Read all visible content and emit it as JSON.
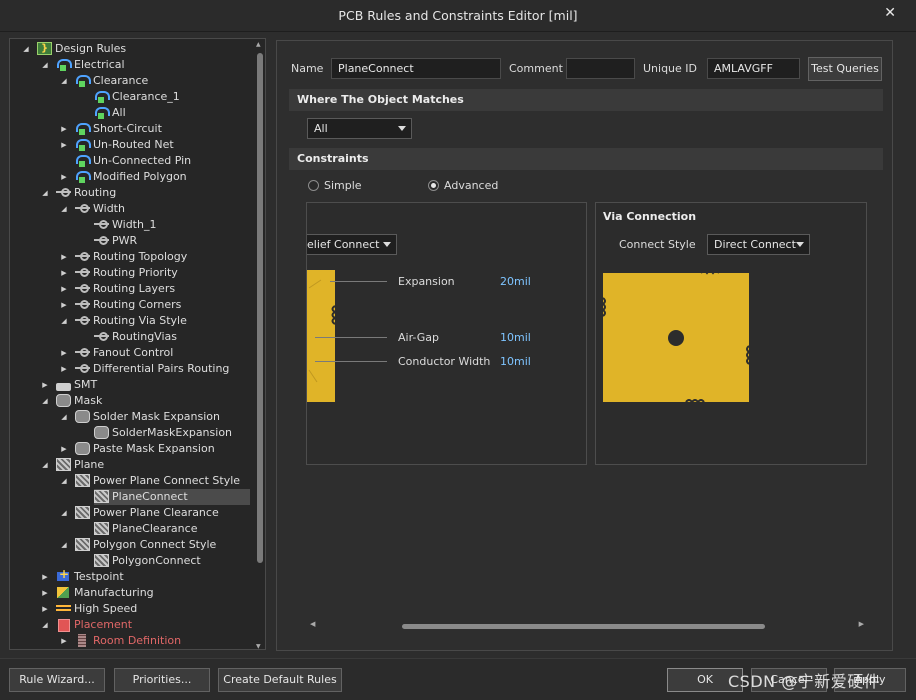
{
  "window": {
    "title": "PCB Rules and Constraints Editor [mil]"
  },
  "tree": {
    "items": [
      {
        "label": "Design Rules",
        "icon": "design-rules-icon",
        "depth": 0,
        "arrow": "down"
      },
      {
        "label": "Electrical",
        "icon": "electrical-icon",
        "depth": 1,
        "arrow": "down"
      },
      {
        "label": "Clearance",
        "icon": "electrical-icon",
        "depth": 2,
        "arrow": "down"
      },
      {
        "label": "Clearance_1",
        "icon": "electrical-icon",
        "depth": 3,
        "arrow": ""
      },
      {
        "label": "All",
        "icon": "electrical-icon",
        "depth": 3,
        "arrow": ""
      },
      {
        "label": "Short-Circuit",
        "icon": "electrical-icon",
        "depth": 2,
        "arrow": "right"
      },
      {
        "label": "Un-Routed Net",
        "icon": "electrical-icon",
        "depth": 2,
        "arrow": "right"
      },
      {
        "label": "Un-Connected Pin",
        "icon": "electrical-icon",
        "depth": 2,
        "arrow": ""
      },
      {
        "label": "Modified Polygon",
        "icon": "electrical-icon",
        "depth": 2,
        "arrow": "right"
      },
      {
        "label": "Routing",
        "icon": "routing-icon",
        "depth": 1,
        "arrow": "down"
      },
      {
        "label": "Width",
        "icon": "routing-icon",
        "depth": 2,
        "arrow": "down"
      },
      {
        "label": "Width_1",
        "icon": "routing-icon",
        "depth": 3,
        "arrow": ""
      },
      {
        "label": "PWR",
        "icon": "routing-icon",
        "depth": 3,
        "arrow": ""
      },
      {
        "label": "Routing Topology",
        "icon": "routing-icon",
        "depth": 2,
        "arrow": "right"
      },
      {
        "label": "Routing Priority",
        "icon": "routing-icon",
        "depth": 2,
        "arrow": "right"
      },
      {
        "label": "Routing Layers",
        "icon": "routing-icon",
        "depth": 2,
        "arrow": "right"
      },
      {
        "label": "Routing Corners",
        "icon": "routing-icon",
        "depth": 2,
        "arrow": "right"
      },
      {
        "label": "Routing Via Style",
        "icon": "routing-icon",
        "depth": 2,
        "arrow": "down"
      },
      {
        "label": "RoutingVias",
        "icon": "routing-icon",
        "depth": 3,
        "arrow": ""
      },
      {
        "label": "Fanout Control",
        "icon": "routing-icon",
        "depth": 2,
        "arrow": "right"
      },
      {
        "label": "Differential Pairs Routing",
        "icon": "routing-icon",
        "depth": 2,
        "arrow": "right"
      },
      {
        "label": "SMT",
        "icon": "smt-icon",
        "depth": 1,
        "arrow": "right"
      },
      {
        "label": "Mask",
        "icon": "mask-icon",
        "depth": 1,
        "arrow": "down"
      },
      {
        "label": "Solder Mask Expansion",
        "icon": "mask-icon",
        "depth": 2,
        "arrow": "down"
      },
      {
        "label": "SolderMaskExpansion",
        "icon": "mask-icon",
        "depth": 3,
        "arrow": ""
      },
      {
        "label": "Paste Mask Expansion",
        "icon": "mask-icon",
        "depth": 2,
        "arrow": "right"
      },
      {
        "label": "Plane",
        "icon": "plane-icon",
        "depth": 1,
        "arrow": "down"
      },
      {
        "label": "Power Plane Connect Style",
        "icon": "plane-icon",
        "depth": 2,
        "arrow": "down"
      },
      {
        "label": "PlaneConnect",
        "icon": "plane-icon",
        "depth": 3,
        "arrow": "",
        "selected": true
      },
      {
        "label": "Power Plane Clearance",
        "icon": "plane-icon",
        "depth": 2,
        "arrow": "down"
      },
      {
        "label": "PlaneClearance",
        "icon": "plane-icon",
        "depth": 3,
        "arrow": ""
      },
      {
        "label": "Polygon Connect Style",
        "icon": "plane-icon",
        "depth": 2,
        "arrow": "down"
      },
      {
        "label": "PolygonConnect",
        "icon": "plane-icon",
        "depth": 3,
        "arrow": ""
      },
      {
        "label": "Testpoint",
        "icon": "testpoint-icon",
        "depth": 1,
        "arrow": "right"
      },
      {
        "label": "Manufacturing",
        "icon": "manufacturing-icon",
        "depth": 1,
        "arrow": "right"
      },
      {
        "label": "High Speed",
        "icon": "high-speed-icon",
        "depth": 1,
        "arrow": "right"
      },
      {
        "label": "Placement",
        "icon": "placement-icon",
        "depth": 1,
        "arrow": "down",
        "red": true
      },
      {
        "label": "Room Definition",
        "icon": "room-definition-icon",
        "depth": 2,
        "arrow": "right",
        "red": true
      }
    ]
  },
  "rule": {
    "name_label": "Name",
    "name_value": "PlaneConnect",
    "comment_label": "Comment",
    "comment_value": "",
    "uid_label": "Unique ID",
    "uid_value": "AMLAVGFF",
    "test_queries": "Test Queries"
  },
  "where": {
    "header": "Where The Object Matches",
    "selected": "All"
  },
  "constraints": {
    "header": "Constraints",
    "simple_label": "Simple",
    "advanced_label": "Advanced",
    "mode": "Advanced",
    "left_dropdown": "elief Connect",
    "expansion_label": "Expansion",
    "expansion_value": "20mil",
    "airgap_label": "Air-Gap",
    "airgap_value": "10mil",
    "conductor_label": "Conductor Width",
    "conductor_value": "10mil",
    "via_header": "Via Connection",
    "connect_style_label": "Connect Style",
    "connect_style_value": "Direct Connect"
  },
  "buttons": {
    "rule_wizard": "Rule Wizard...",
    "priorities": "Priorities...",
    "create_default": "Create Default Rules",
    "ok": "OK",
    "cancel": "Cancel",
    "apply": "Apply"
  },
  "watermark": "CSDN @宁新爱硬件",
  "colors": {
    "copper": "#e0b428",
    "accent_value": "#7ec4ff",
    "warning_text": "#e06767"
  }
}
